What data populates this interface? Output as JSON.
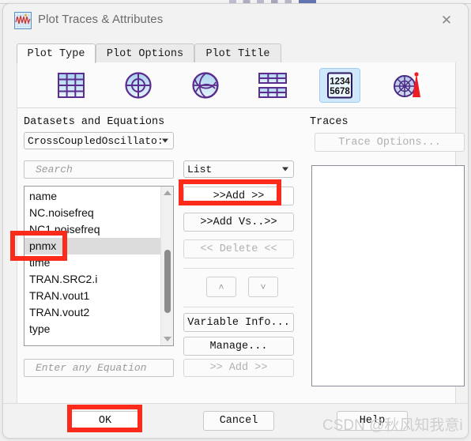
{
  "window": {
    "title": "Plot Traces & Attributes",
    "app_icon": "waveform-plot-icon",
    "close_label": "✕"
  },
  "tabs": [
    {
      "label": "Plot Type",
      "active": true
    },
    {
      "label": "Plot Options",
      "active": false
    },
    {
      "label": "Plot Title",
      "active": false
    }
  ],
  "plot_types": [
    {
      "name": "rectangular-plot-icon",
      "selected": false
    },
    {
      "name": "polar-plot-icon",
      "selected": false
    },
    {
      "name": "smith-chart-icon",
      "selected": false
    },
    {
      "name": "stacked-plot-icon",
      "selected": false
    },
    {
      "name": "data-table-icon",
      "selected": true,
      "digits_top": "1234",
      "digits_bottom": "5678"
    },
    {
      "name": "antenna-pattern-icon",
      "selected": false
    }
  ],
  "datasets": {
    "section_label": "Datasets and Equations",
    "dataset_value": "CrossCoupledOscillato:",
    "search_placeholder": "Search",
    "equation_placeholder": "Enter any Equation",
    "equation_add_label": ">> Add >>",
    "items": [
      {
        "label": "name",
        "selected": false
      },
      {
        "label": "NC.noisefreq",
        "selected": false
      },
      {
        "label": "NC1.noisefreq",
        "selected": false
      },
      {
        "label": "pnmx",
        "selected": true
      },
      {
        "label": "time",
        "selected": false
      },
      {
        "label": "TRAN.SRC2.i",
        "selected": false
      },
      {
        "label": "TRAN.vout1",
        "selected": false
      },
      {
        "label": "TRAN.vout2",
        "selected": false
      },
      {
        "label": "type",
        "selected": false
      }
    ]
  },
  "middle": {
    "list_mode": "List",
    "add_label": ">>Add >>",
    "add_vs_label": ">>Add Vs..>>",
    "delete_label": "<< Delete <<",
    "move_up_label": "˄",
    "move_down_label": "˅",
    "variable_info_label": "Variable Info...",
    "manage_label": "Manage..."
  },
  "traces": {
    "section_label": "Traces",
    "trace_options_label": "Trace Options...",
    "items": []
  },
  "footer": {
    "ok_label": "OK",
    "cancel_label": "Cancel",
    "help_label": "Help"
  },
  "watermark": {
    "text": "CSDN @秋风知我意i"
  },
  "colors": {
    "annotation_red": "#fb2a1b",
    "selected_icon_bg": "#cfe8fb",
    "list_selection": "#dcdcdc",
    "icon_purple": "#5b2d8e"
  }
}
